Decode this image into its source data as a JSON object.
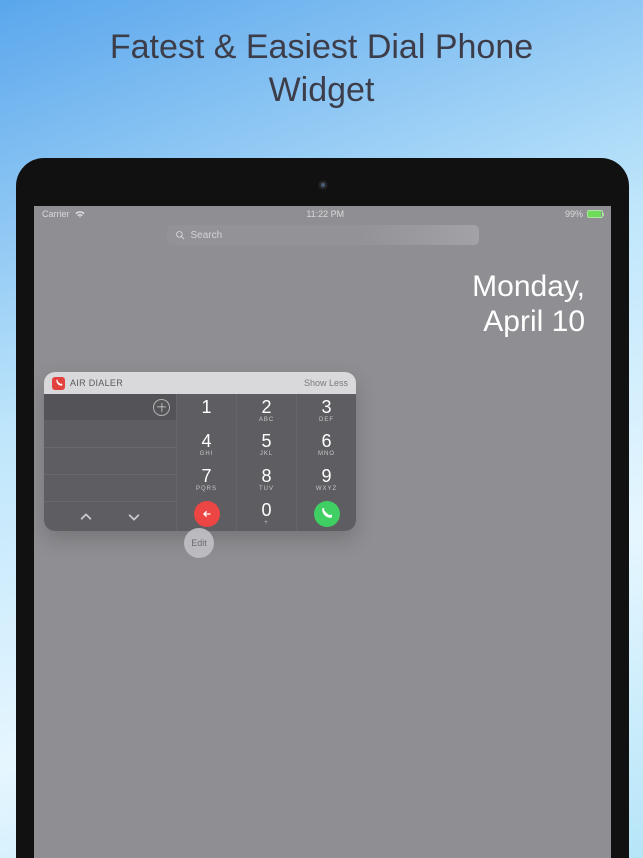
{
  "hero": {
    "line1": "Fatest & Easiest Dial Phone",
    "line2": "Widget"
  },
  "status": {
    "carrier": "Carrier",
    "time": "11:22 PM",
    "battery_pct": "99%"
  },
  "search": {
    "placeholder": "Search"
  },
  "date": {
    "line1": "Monday,",
    "line2": "April 10"
  },
  "widget": {
    "app_name": "AIR DIALER",
    "show_less": "Show Less",
    "keys": [
      {
        "d": "1",
        "l": ""
      },
      {
        "d": "2",
        "l": "ABC"
      },
      {
        "d": "3",
        "l": "DEF"
      },
      {
        "d": "4",
        "l": "GHI"
      },
      {
        "d": "5",
        "l": "JKL"
      },
      {
        "d": "6",
        "l": "MNO"
      },
      {
        "d": "7",
        "l": "PQRS"
      },
      {
        "d": "8",
        "l": "TUV"
      },
      {
        "d": "9",
        "l": "WXYZ"
      },
      {
        "d": "0",
        "l": "+"
      }
    ]
  },
  "edit_label": "Edit"
}
